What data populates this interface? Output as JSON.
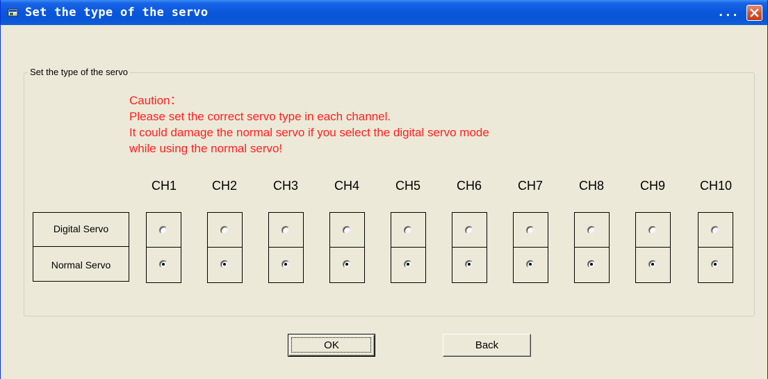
{
  "window": {
    "title": "Set the type of the servo",
    "title_extra": "...",
    "close_icon": "close-icon"
  },
  "group": {
    "label": "Set the type of the servo"
  },
  "caution": {
    "lines": [
      "Caution：",
      "Please set the correct servo type in each channel.",
      "It could damage the normal servo if you select the digital servo mode",
      "while using the normal servo!"
    ],
    "color": "#ff2020"
  },
  "rows": {
    "digital": "Digital Servo",
    "normal": "Normal Servo"
  },
  "channels": [
    {
      "label": "CH1",
      "selected": "normal"
    },
    {
      "label": "CH2",
      "selected": "normal"
    },
    {
      "label": "CH3",
      "selected": "normal"
    },
    {
      "label": "CH4",
      "selected": "normal"
    },
    {
      "label": "CH5",
      "selected": "normal"
    },
    {
      "label": "CH6",
      "selected": "normal"
    },
    {
      "label": "CH7",
      "selected": "normal"
    },
    {
      "label": "CH8",
      "selected": "normal"
    },
    {
      "label": "CH9",
      "selected": "normal"
    },
    {
      "label": "CH10",
      "selected": "normal"
    }
  ],
  "buttons": {
    "ok": "OK",
    "back": "Back"
  }
}
